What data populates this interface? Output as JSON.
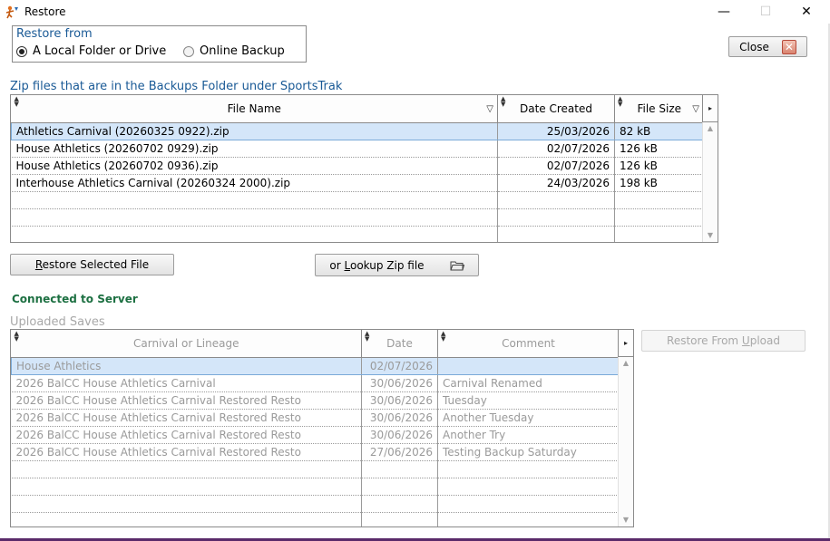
{
  "window": {
    "title": "Restore",
    "minimize_glyph": "—",
    "maximize_glyph": "☐",
    "close_glyph": "✕"
  },
  "restore_from": {
    "label": "Restore from",
    "options": [
      {
        "label": "A Local Folder or Drive",
        "selected": true
      },
      {
        "label": "Online Backup",
        "selected": false
      }
    ]
  },
  "close_button": {
    "label": "Close",
    "icon": "close-x-icon"
  },
  "local": {
    "section_label": "Zip files that are in the Backups Folder under SportsTrak",
    "columns": [
      "File Name",
      "Date Created",
      "File Size"
    ],
    "rows": [
      {
        "file_name": "Athletics Carnival (20260325 0922).zip",
        "date_created": "25/03/2026",
        "file_size": "82 kB",
        "selected": true
      },
      {
        "file_name": "House Athletics (20260702 0929).zip",
        "date_created": "02/07/2026",
        "file_size": "126 kB",
        "selected": false
      },
      {
        "file_name": "House Athletics (20260702 0936).zip",
        "date_created": "02/07/2026",
        "file_size": "126 kB",
        "selected": false
      },
      {
        "file_name": "Interhouse Athletics Carnival (20260324 2000).zip",
        "date_created": "24/03/2026",
        "file_size": "198 kB",
        "selected": false
      }
    ],
    "empty_rows": 3
  },
  "restore_selected": {
    "prefix": "",
    "underline": "R",
    "rest": "estore Selected File"
  },
  "lookup_zip": {
    "prefix": "or ",
    "underline": "L",
    "rest": "ookup Zip file",
    "icon": "folder-open-icon"
  },
  "server": {
    "status": "Connected to Server",
    "section_label": "Uploaded Saves",
    "columns": [
      "Carnival or Lineage",
      "Date",
      "Comment"
    ],
    "rows": [
      {
        "carnival": "House Athletics",
        "date": "02/07/2026",
        "comment": "",
        "selected": true
      },
      {
        "carnival": "2026 BalCC House Athletics Carnival",
        "date": "30/06/2026",
        "comment": "Carnival Renamed",
        "selected": false
      },
      {
        "carnival": "2026 BalCC House Athletics Carnival Restored Resto",
        "date": "30/06/2026",
        "comment": "Tuesday",
        "selected": false
      },
      {
        "carnival": "2026 BalCC House Athletics Carnival Restored Resto",
        "date": "30/06/2026",
        "comment": "Another Tuesday",
        "selected": false
      },
      {
        "carnival": "2026 BalCC House Athletics Carnival Restored Resto",
        "date": "30/06/2026",
        "comment": "Another Try",
        "selected": false
      },
      {
        "carnival": "2026 BalCC House Athletics Carnival Restored Resto",
        "date": "27/06/2026",
        "comment": "Testing Backup Saturday",
        "selected": false
      }
    ],
    "empty_rows": 4
  },
  "restore_from_upload": {
    "prefix": "Restore From ",
    "underline": "U",
    "rest": "pload"
  }
}
